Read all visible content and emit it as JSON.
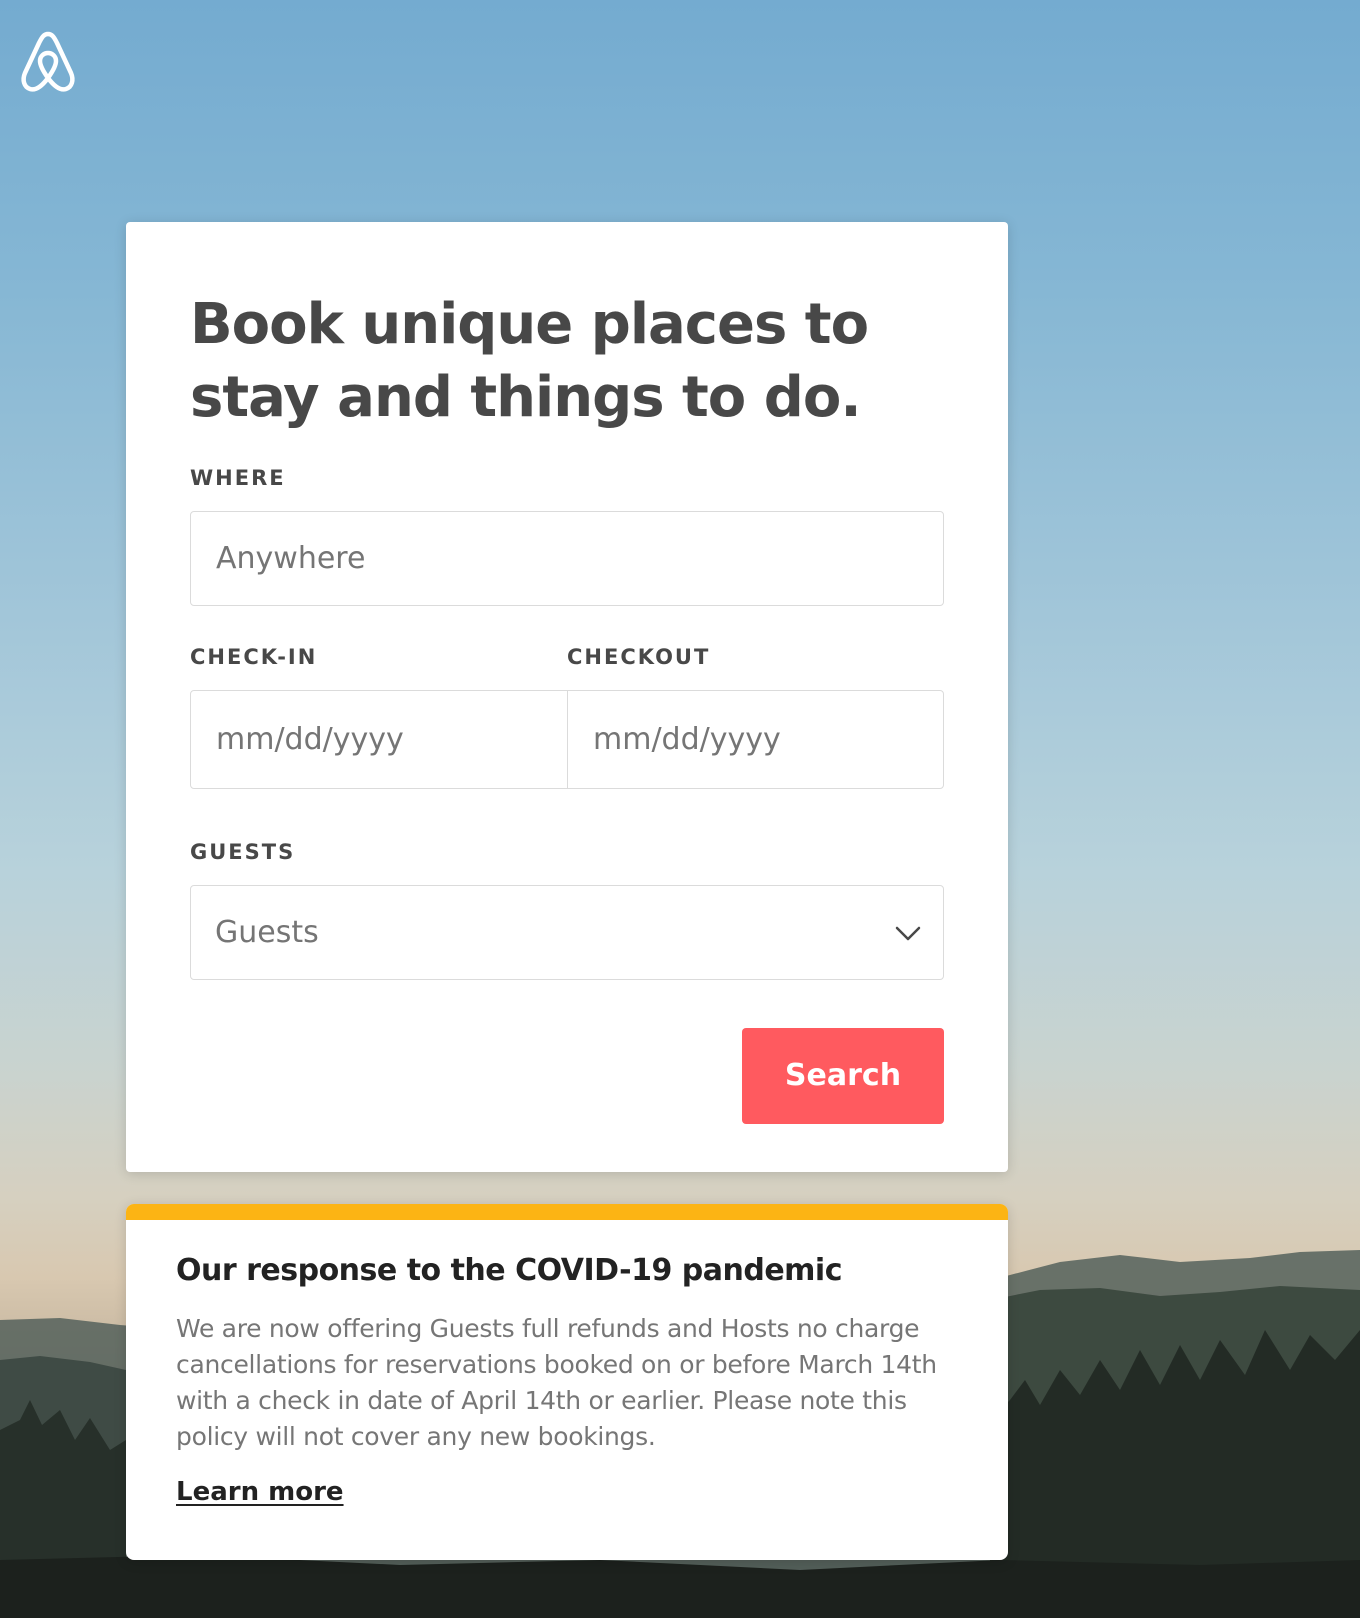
{
  "brand": {
    "logo_icon": "airbnb-belo-icon",
    "accent_color": "#ff5a5f",
    "notice_color": "#fcb414"
  },
  "search_card": {
    "headline": "Book unique places to stay and things to do.",
    "where": {
      "label": "WHERE",
      "placeholder": "Anywhere"
    },
    "check_in": {
      "label": "CHECK-IN",
      "placeholder": "mm/dd/yyyy"
    },
    "checkout": {
      "label": "CHECKOUT",
      "placeholder": "mm/dd/yyyy"
    },
    "guests": {
      "label": "GUESTS",
      "selected": "Guests",
      "dropdown_icon": "chevron-down-icon"
    },
    "search_button_label": "Search"
  },
  "covid_notice": {
    "title": "Our response to the COVID-19 pandemic",
    "body": "We are now offering Guests full refunds and Hosts no charge cancellations for reservations booked on or before March 14th with a check in date of April 14th or earlier. Please note this policy will not cover any new bookings.",
    "link_label": "Learn more"
  }
}
